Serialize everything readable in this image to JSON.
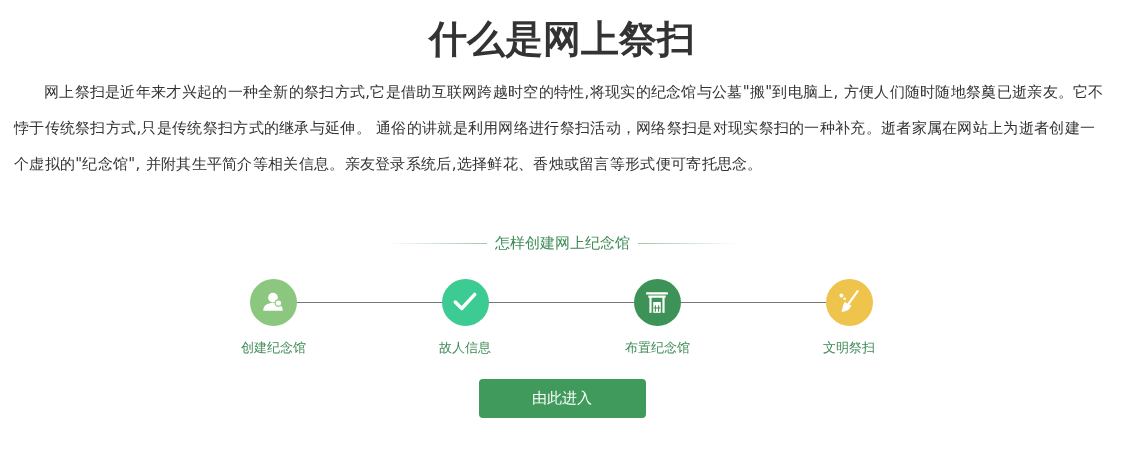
{
  "title": "什么是网上祭扫",
  "intro": "网上祭扫是近年来才兴起的一种全新的祭扫方式,它是借助互联网跨越时空的特性,将现实的纪念馆与公墓\"搬\"到电脑上, 方便人们随时随地祭奠已逝亲友。它不悖于传统祭扫方式,只是传统祭扫方式的继承与延伸。 通俗的讲就是利用网络进行祭扫活动，网络祭扫是对现实祭扫的一种补充。逝者家属在网站上为逝者创建一个虚拟的\"纪念馆\", 并附其生平简介等相关信息。亲友登录系统后,选择鲜花、香烛或留言等形式便可寄托思念。",
  "section_title": "怎样创建网上纪念馆",
  "steps": [
    {
      "label": "创建纪念馆",
      "kind": "person",
      "color": "#8cc77f"
    },
    {
      "label": "故人信息",
      "kind": "check",
      "color": "#3ccb92"
    },
    {
      "label": "布置纪念馆",
      "kind": "hall",
      "color": "#3d9357"
    },
    {
      "label": "文明祭扫",
      "kind": "broom",
      "color": "#efc44c"
    }
  ],
  "enter_button": "由此进入"
}
